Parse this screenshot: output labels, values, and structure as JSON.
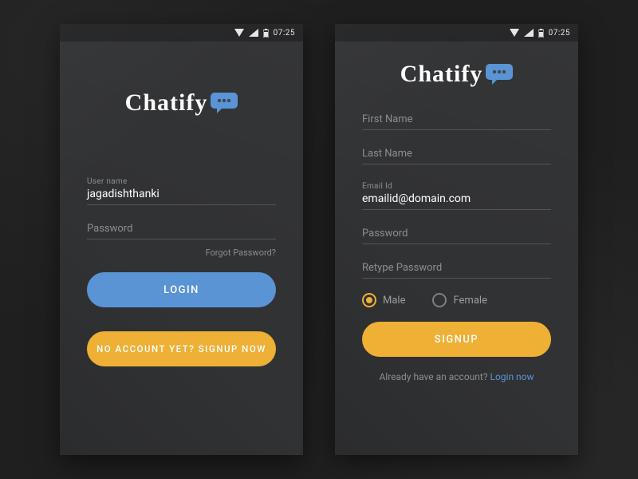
{
  "status": {
    "time": "07:25"
  },
  "brand": {
    "name": "Chatify"
  },
  "colors": {
    "blue": "#5a94d5",
    "yellow": "#eeb035"
  },
  "login": {
    "username_label": "User name",
    "username_value": "jagadishthanki",
    "password_placeholder": "Password",
    "forgot": "Forgot Password?",
    "login_label": "LOGIN",
    "signup_prompt": "NO ACCOUNT YET? SIGNUP NOW"
  },
  "signup": {
    "first_name_placeholder": "First Name",
    "last_name_placeholder": "Last Name",
    "email_label": "Email Id",
    "email_value": "emailid@domain.com",
    "password_placeholder": "Password",
    "retype_placeholder": "Retype Password",
    "gender": {
      "male": "Male",
      "female": "Female",
      "selected": "male"
    },
    "signup_label": "SIGNUP",
    "already_text": "Already have an account? ",
    "login_link": "Login now"
  }
}
